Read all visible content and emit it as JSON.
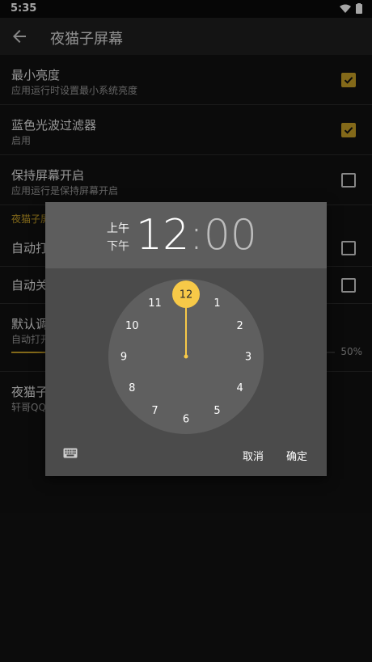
{
  "status": {
    "time": "5:35"
  },
  "appbar": {
    "title": "夜猫子屏幕"
  },
  "prefs": [
    {
      "title": "最小亮度",
      "subtitle": "应用运行时设置最小系统亮度",
      "checked": true
    },
    {
      "title": "蓝色光波过滤器",
      "subtitle": "启用",
      "checked": true
    },
    {
      "title": "保持屏幕开启",
      "subtitle": "应用运行是保持屏幕开启",
      "checked": false
    }
  ],
  "category": {
    "label": "夜猫子屏"
  },
  "auto_prefs": [
    {
      "title": "自动打",
      "checked": false
    },
    {
      "title": "自动关",
      "checked": false
    }
  ],
  "slider_pref": {
    "title": "默认调",
    "subtitle": "自动打开",
    "value": 0.5,
    "value_label": "50%"
  },
  "about_pref": {
    "title": "夜猫子",
    "subtitle": "轩哥QQ"
  },
  "dialog": {
    "am": "上午",
    "pm": "下午",
    "hour": "12",
    "colon": ":",
    "minute": "00",
    "selected_hour": 12,
    "clock_numbers": [
      "12",
      "1",
      "2",
      "3",
      "4",
      "5",
      "6",
      "7",
      "8",
      "9",
      "10",
      "11"
    ],
    "cancel_label": "取消",
    "ok_label": "确定"
  },
  "colors": {
    "accent": "#c9a227",
    "selector": "#f7c948",
    "clock_face": "#5f5f5f"
  }
}
